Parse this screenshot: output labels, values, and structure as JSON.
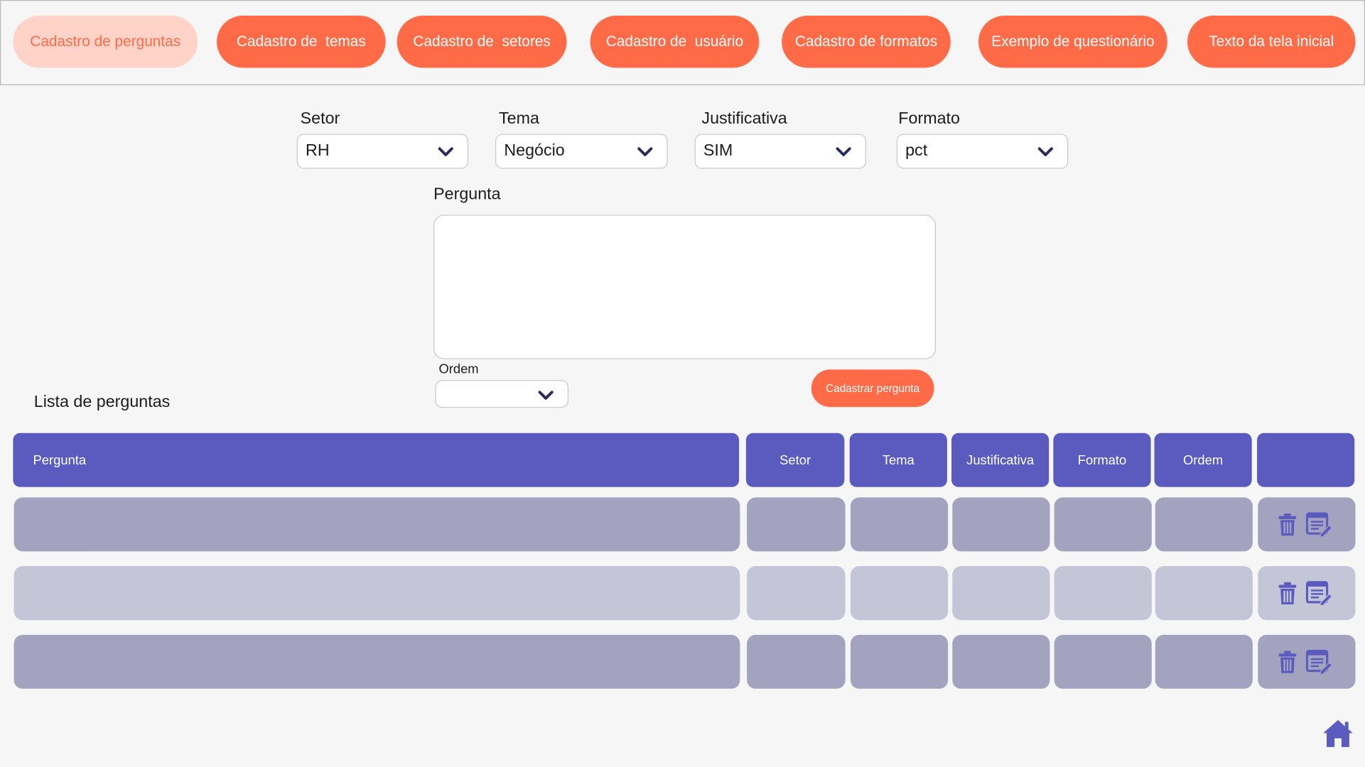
{
  "nav": {
    "items": [
      {
        "label": "Cadastro de perguntas",
        "active": true
      },
      {
        "label": "Cadastro de  temas",
        "active": false
      },
      {
        "label": "Cadastro de  setores",
        "active": false
      },
      {
        "label": "Cadastro de  usuário",
        "active": false
      },
      {
        "label": "Cadastro de formatos",
        "active": false
      },
      {
        "label": "Exemplo de questionário",
        "active": false
      },
      {
        "label": "Texto da tela inicial",
        "active": false
      }
    ]
  },
  "form": {
    "setor": {
      "label": "Setor",
      "value": "RH"
    },
    "tema": {
      "label": "Tema",
      "value": "Negócio"
    },
    "justificativa": {
      "label": "Justificativa",
      "value": "SIM"
    },
    "formato": {
      "label": "Formato",
      "value": "pct"
    },
    "pergunta": {
      "label": "Pergunta",
      "value": ""
    },
    "ordem": {
      "label": "Ordem",
      "value": ""
    },
    "submit_label": "Cadastrar pergunta"
  },
  "list": {
    "title": "Lista de perguntas",
    "columns": [
      "Pergunta",
      "Setor",
      "Tema",
      "Justificativa",
      "Formato",
      "Ordem",
      ""
    ],
    "rows": [
      {
        "cells": [
          "",
          "",
          "",
          "",
          "",
          ""
        ]
      },
      {
        "cells": [
          "",
          "",
          "",
          "",
          "",
          ""
        ]
      },
      {
        "cells": [
          "",
          "",
          "",
          "",
          "",
          ""
        ]
      }
    ]
  },
  "icons": {
    "chevron": "chevron-down-icon",
    "delete": "trash-icon",
    "edit": "edit-document-icon",
    "home": "home-icon"
  },
  "colors": {
    "accent": "#ff6b47",
    "accent_active_bg": "#ffd3c8",
    "header": "#5b5bbf",
    "row_dark": "#a3a3c0",
    "row_light": "#c5c5d8",
    "icon": "#5b5bbf",
    "chevron": "#2b2b5a"
  }
}
